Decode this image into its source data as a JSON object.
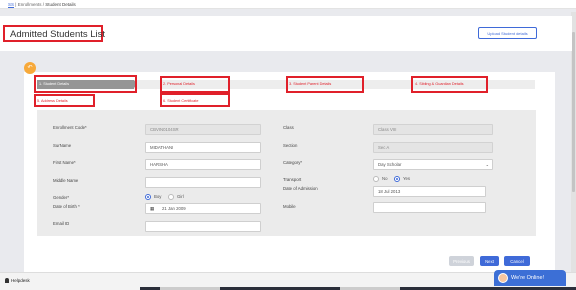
{
  "breadcrumb": {
    "home": "SS",
    "sep1": "|",
    "enrollments": "Enrollments",
    "sep2": "/",
    "current": "Student Details"
  },
  "header": {
    "title": "Admitted Students List",
    "upload_label": "Upload Student details"
  },
  "back_icon": "arrow-left-icon",
  "tabs": [
    {
      "label": "1. Student Details",
      "active": true
    },
    {
      "label": "2. Personal Details"
    },
    {
      "label": "3. Student Parent Details"
    },
    {
      "label": "4. Sibling & Guardian Details"
    },
    {
      "label": "5. Address Details"
    },
    {
      "label": "6. Student Certificate"
    }
  ],
  "form": {
    "enrollment_code": {
      "label": "Enrollment Code*",
      "value": "CBVIN0104SR"
    },
    "surname": {
      "label": "SurName",
      "value": "MIDATHANI"
    },
    "first_name": {
      "label": "First Name*",
      "value": "HARSHA"
    },
    "middle_name": {
      "label": "Middle Name",
      "value": ""
    },
    "gender": {
      "label": "Gender*",
      "options": [
        "Boy",
        "Girl"
      ],
      "selected": "Boy"
    },
    "dob": {
      "label": "Date of Birth *",
      "value": "21 Jan 2009"
    },
    "email": {
      "label": "Email ID",
      "value": ""
    },
    "class": {
      "label": "Class",
      "value": "Class VIII"
    },
    "section": {
      "label": "Section",
      "value": "Sec A"
    },
    "category": {
      "label": "Category*",
      "value": "Day Scholar"
    },
    "transport": {
      "label": "Transport",
      "options": [
        "No",
        "Yes"
      ],
      "selected": "Yes"
    },
    "admission_date": {
      "label": "Date of Admission",
      "value": "18 Jul 2013"
    },
    "mobile": {
      "label": "Mobile",
      "value": ""
    }
  },
  "buttons": {
    "previous": "Previous",
    "next": "Next",
    "cancel": "Cancel"
  },
  "footer": {
    "helpdesk": "Helpdesk",
    "chat": "We're Online!"
  },
  "colors": {
    "accent": "#3f6ad8",
    "highlight": "#e0202a",
    "back": "#f7a93a",
    "chat": "#3c6fd6"
  }
}
